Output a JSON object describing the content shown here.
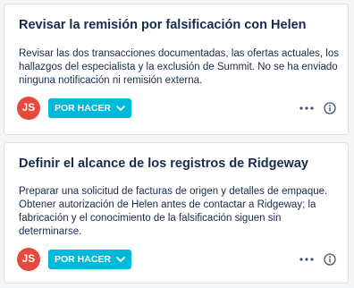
{
  "cards": [
    {
      "title": "Revisar la remisión por falsificación con Helen",
      "description": "Revisar las dos transacciones documentadas, las ofertas actuales, los hallazgos del especialista y la exclusión de Summit. No se ha enviado ninguna notificación ni remisión externa.",
      "assignee_initials": "JS",
      "status_label": "POR HACER"
    },
    {
      "title": "Definir el alcance de los registros de Ridgeway",
      "description": "Preparar una solicitud de facturas de origen y detalles de empaque. Obtener autorización de Helen antes de contactar a Ridgeway; la fabricación y el conocimiento de la falsificación siguen sin determinarse.",
      "assignee_initials": "JS",
      "status_label": "POR HACER"
    }
  ],
  "colors": {
    "avatar": "#e34a3c",
    "status": "#00b8d9",
    "text": "#172b4d"
  },
  "icons": {
    "status_chevron": "chevron-down-icon",
    "more": "more-horizontal-icon",
    "info": "info-icon"
  }
}
